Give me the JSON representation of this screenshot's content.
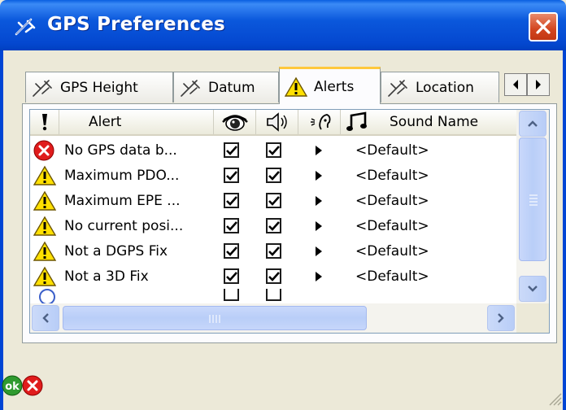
{
  "window": {
    "title": "GPS Preferences",
    "title_icon": "satellite-icon",
    "close_icon": "close-icon"
  },
  "tabs": [
    {
      "label": "GPS Height",
      "icon": "satellite-icon",
      "active": false
    },
    {
      "label": "Datum",
      "icon": "satellite-icon",
      "active": false
    },
    {
      "label": "Alerts",
      "icon": "warning-icon",
      "active": true
    },
    {
      "label": "Location",
      "icon": "satellite-icon",
      "active": false
    }
  ],
  "tab_scroll": {
    "left_icon": "chevron-left-icon",
    "right_icon": "chevron-right-icon"
  },
  "list": {
    "columns": [
      {
        "label": "",
        "icon": "exclamation-icon"
      },
      {
        "label": "Alert",
        "icon": ""
      },
      {
        "label": "",
        "icon": "eye-icon"
      },
      {
        "label": "",
        "icon": "speaker-icon"
      },
      {
        "label": "",
        "icon": "speech-icon"
      },
      {
        "label": "",
        "icon": "music-note-icon"
      },
      {
        "label": "Sound Name",
        "icon": ""
      }
    ],
    "rows": [
      {
        "severity": "error",
        "alert": "No GPS data b...",
        "visible": true,
        "audible": true,
        "sound": "<Default>"
      },
      {
        "severity": "warning",
        "alert": "Maximum PDO...",
        "visible": true,
        "audible": true,
        "sound": "<Default>"
      },
      {
        "severity": "warning",
        "alert": "Maximum EPE ...",
        "visible": true,
        "audible": true,
        "sound": "<Default>"
      },
      {
        "severity": "warning",
        "alert": "No current posi...",
        "visible": true,
        "audible": true,
        "sound": "<Default>"
      },
      {
        "severity": "warning",
        "alert": "Not a DGPS Fix",
        "visible": true,
        "audible": true,
        "sound": "<Default>"
      },
      {
        "severity": "warning",
        "alert": "Not a 3D Fix",
        "visible": true,
        "audible": true,
        "sound": "<Default>"
      }
    ]
  },
  "footer": {
    "ok_label": "ok",
    "cancel_icon": "cancel-icon"
  },
  "colors": {
    "titlebar": "#0054e3",
    "close_button": "#d2451f",
    "window_bg": "#ece9d8",
    "active_tab_highlight": "#ffc83c",
    "scroll_thumb": "#b9cef8"
  }
}
